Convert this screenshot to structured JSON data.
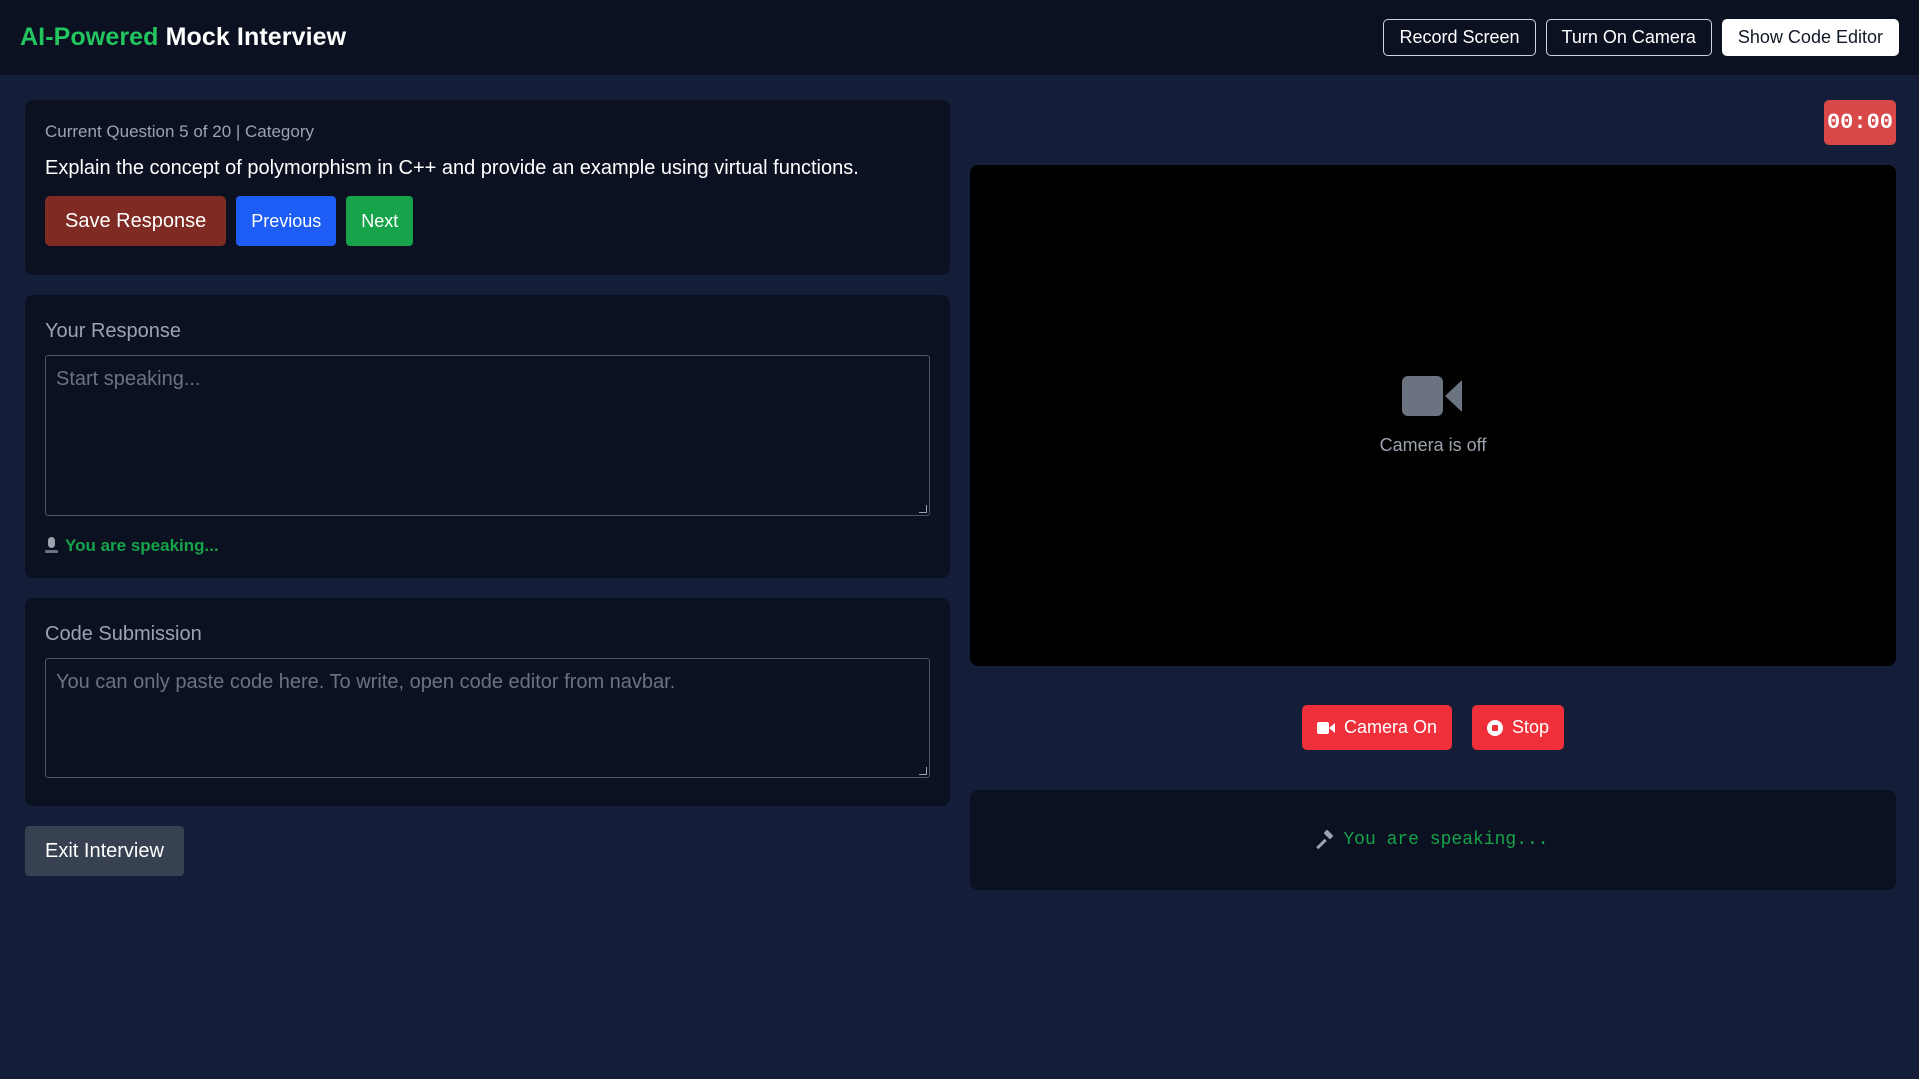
{
  "navbar": {
    "brand_accent": "AI-Powered",
    "brand_rest": "Mock Interview",
    "record_screen": "Record Screen",
    "turn_on_camera": "Turn On Camera",
    "show_code_editor": "Show Code Editor"
  },
  "question": {
    "meta": "Current Question 5 of 20 | Category",
    "text": "Explain the concept of polymorphism in C++ and provide an example using virtual functions.",
    "save_label": "Save Response",
    "previous_label": "Previous",
    "next_label": "Next"
  },
  "response": {
    "label": "Your Response",
    "placeholder": "Start speaking...",
    "speaking_status": "You are speaking..."
  },
  "code": {
    "label": "Code Submission",
    "placeholder": "You can only paste code here. To write, open code editor from navbar."
  },
  "exit_label": "Exit Interview",
  "timer": "00:00",
  "video": {
    "camera_off_text": "Camera is off",
    "camera_on_label": "Camera On",
    "stop_label": "Stop"
  },
  "speaking_panel": {
    "text": "You are speaking..."
  },
  "colors": {
    "background": "#141e38",
    "panel": "#0b1120",
    "accent_green": "#22c55e",
    "save": "#7f2a22",
    "previous": "#1d5cf5",
    "next": "#16a34a",
    "danger": "#ef2f3a"
  }
}
